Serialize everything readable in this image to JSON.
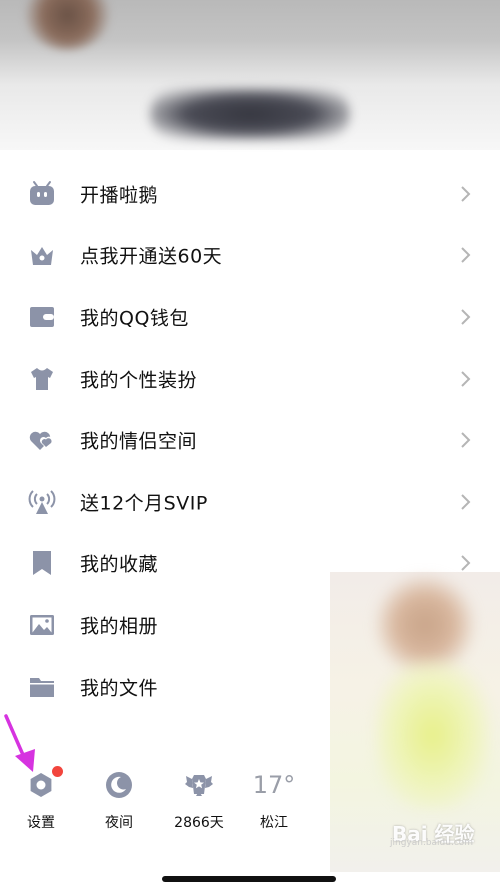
{
  "menu": {
    "items": [
      {
        "label": "开播啦鹅",
        "icon": "tv-bot-icon"
      },
      {
        "label": "点我开通送60天",
        "icon": "crown-icon"
      },
      {
        "label": "我的QQ钱包",
        "icon": "wallet-icon"
      },
      {
        "label": "我的个性装扮",
        "icon": "shirt-icon"
      },
      {
        "label": "我的情侣空间",
        "icon": "hearts-icon"
      },
      {
        "label": "送12个月SVIP",
        "icon": "broadcast-icon"
      },
      {
        "label": "我的收藏",
        "icon": "bookmark-icon"
      },
      {
        "label": "我的相册",
        "icon": "photo-icon"
      },
      {
        "label": "我的文件",
        "icon": "folder-icon"
      }
    ]
  },
  "bottom_bar": {
    "settings_label": "设置",
    "night_label": "夜间",
    "days_label": "2866天",
    "weather_temp": "17°",
    "city_label": "松江"
  },
  "watermark": {
    "text": "Bai 经验",
    "sub": "jingyan.baidu.com"
  },
  "colors": {
    "icon": "#8c93a8",
    "notification_dot": "#f2453d",
    "annotation_arrow": "#d633e0",
    "chevron": "#b5b5b5"
  }
}
